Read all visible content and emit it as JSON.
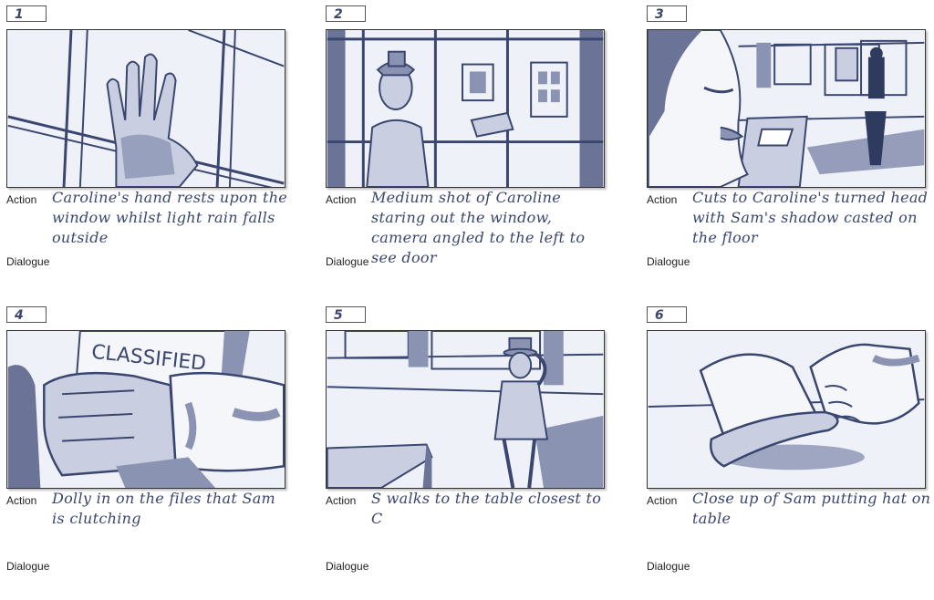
{
  "panels": [
    {
      "number": "1",
      "action_label": "Action",
      "action_text": "Caroline's hand rests upon the window whilst light rain falls outside",
      "dialogue_label": "Dialogue"
    },
    {
      "number": "2",
      "action_label": "Action",
      "action_text": "Medium shot of Caroline staring out the window, camera angled to the left to see door",
      "dialogue_label": "Dialogue"
    },
    {
      "number": "3",
      "action_label": "Action",
      "action_text": "Cuts to Caroline's turned head with Sam's shadow casted on the floor",
      "dialogue_label": "Dialogue"
    },
    {
      "number": "4",
      "action_label": "Action",
      "action_text": "Dolly in on the files that Sam is clutching",
      "dialogue_label": "Dialogue",
      "sign_text": "CLASSIFIED"
    },
    {
      "number": "5",
      "action_label": "Action",
      "action_text": "S walks to the table closest to C",
      "dialogue_label": "Dialogue"
    },
    {
      "number": "6",
      "action_label": "Action",
      "action_text": "Close up of Sam putting hat on table",
      "dialogue_label": "Dialogue"
    }
  ],
  "colors": {
    "ink": "#3a466f",
    "shade": "#8b93b3",
    "light": "#c9cfe0"
  }
}
